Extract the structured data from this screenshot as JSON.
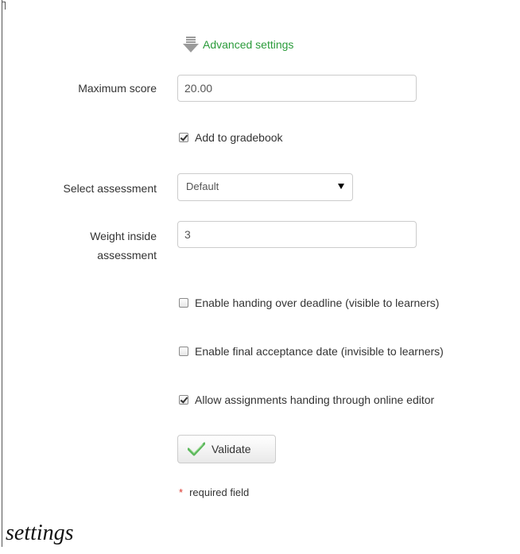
{
  "advanced": {
    "label": "Advanced settings",
    "icon": "download-arrow-icon",
    "color": "#2a9b3a"
  },
  "fields": {
    "max_score": {
      "label": "Maximum score",
      "value": "20.00"
    },
    "add_gradebook": {
      "label": "Add to gradebook",
      "checked": true
    },
    "select_assessment": {
      "label": "Select assessment",
      "value": "Default"
    },
    "weight": {
      "label_line1": "Weight inside",
      "label_line2": "assessment",
      "value": "3"
    },
    "handing_over_deadline": {
      "label": "Enable handing over deadline (visible to learners)",
      "checked": false
    },
    "final_acceptance": {
      "label": "Enable final acceptance date (invisible to learners)",
      "checked": false
    },
    "online_editor": {
      "label": "Allow assignments handing through online editor",
      "checked": true
    }
  },
  "validate_button": {
    "label": "Validate",
    "icon": "check-icon"
  },
  "required_note": {
    "star": "*",
    "text": "required field"
  },
  "footer": {
    "title": "settings"
  }
}
